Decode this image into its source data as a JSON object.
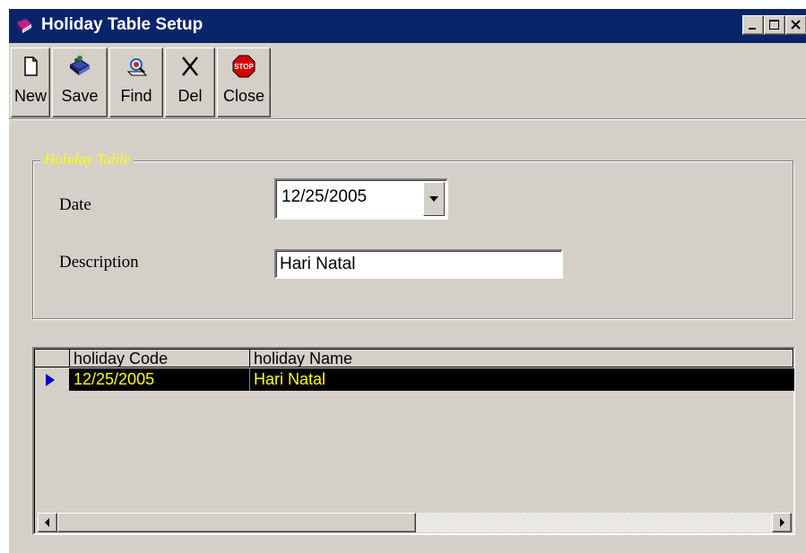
{
  "window": {
    "title": "Holiday Table Setup",
    "controls": [
      "minimize-icon",
      "maximize-icon",
      "close-icon"
    ]
  },
  "toolbar": {
    "new_label": "New",
    "save_label": "Save",
    "find_label": "Find",
    "del_label": "Del",
    "close_label": "Close"
  },
  "form": {
    "group_title": "Holiday Table",
    "date_label": "Date",
    "date_value": "12/25/2005",
    "description_label": "Description",
    "description_value": "Hari Natal"
  },
  "grid": {
    "columns": [
      "holiday Code",
      "holiday Name"
    ],
    "rows": [
      {
        "code": "12/25/2005",
        "name": "Hari Natal"
      }
    ]
  },
  "colors": {
    "titlebar": "#0a246a",
    "face": "#d4d0c8",
    "group_title": "#ffff00",
    "selected_row_bg": "#000000",
    "selected_row_text": "#ffff00"
  }
}
